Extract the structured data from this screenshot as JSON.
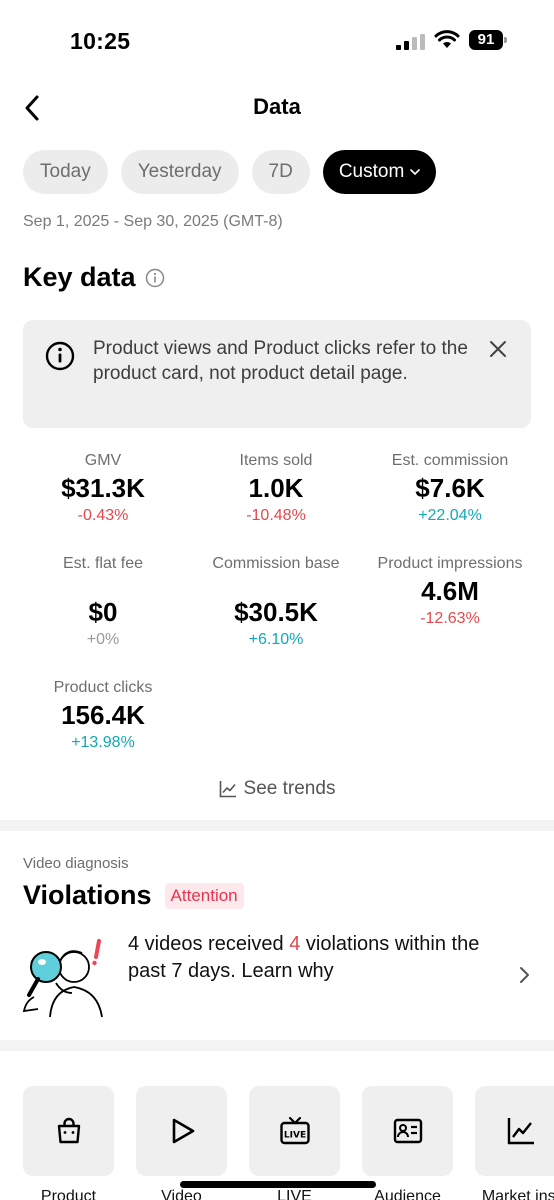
{
  "status_bar": {
    "time": "10:25",
    "battery": "91"
  },
  "header": {
    "title": "Data"
  },
  "range_tabs": [
    {
      "label": "Today",
      "active": false
    },
    {
      "label": "Yesterday",
      "active": false
    },
    {
      "label": "7D",
      "active": false
    },
    {
      "label": "Custom",
      "active": true
    }
  ],
  "date_range": "Sep 1, 2025 - Sep 30, 2025 (GMT-8)",
  "key_data": {
    "title": "Key data",
    "notice": "Product views and Product clicks refer to the product card, not product detail page.",
    "metrics": [
      {
        "label": "GMV",
        "value": "$31.3K",
        "change": "-0.43%",
        "trend": "negative"
      },
      {
        "label": "Items sold",
        "value": "1.0K",
        "change": "-10.48%",
        "trend": "negative"
      },
      {
        "label": "Est. commission",
        "value": "$7.6K",
        "change": "+22.04%",
        "trend": "positive"
      },
      {
        "label": "Est. flat fee",
        "value": "$0",
        "change": "+0%",
        "trend": "neutral"
      },
      {
        "label": "Commission base",
        "value": "$30.5K",
        "change": "+6.10%",
        "trend": "positive"
      },
      {
        "label": "Product impressions",
        "value": "4.6M",
        "change": "-12.63%",
        "trend": "negative"
      },
      {
        "label": "Product clicks",
        "value": "156.4K",
        "change": "+13.98%",
        "trend": "positive"
      }
    ],
    "see_trends": "See trends"
  },
  "video_diagnosis": {
    "subtitle": "Video diagnosis",
    "title": "Violations",
    "badge": "Attention",
    "message": {
      "videos_count": "4",
      "part1": " videos received ",
      "violations_count": "4",
      "part2": " violations within the past 7 days. Learn why"
    }
  },
  "tools": [
    {
      "label": "Product",
      "icon": "shopping-bag-icon"
    },
    {
      "label": "Video",
      "icon": "play-icon"
    },
    {
      "label": "LIVE",
      "icon": "live-tv-icon"
    },
    {
      "label": "Audience",
      "icon": "id-card-icon"
    },
    {
      "label": "Market insi",
      "icon": "line-chart-icon"
    }
  ],
  "colors": {
    "negative": "#e5484d",
    "positive": "#12a8b5",
    "neutral": "#9a9a9a",
    "attention_bg": "#fde8ec",
    "attention_text": "#e8344f"
  }
}
